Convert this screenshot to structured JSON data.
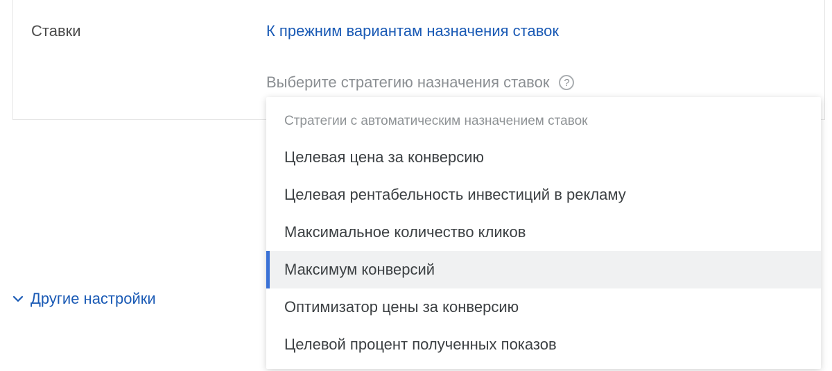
{
  "section_label": "Ставки",
  "back_link": "К прежним вариантам назначения ставок",
  "subheading": "Выберите стратегию назначения ставок",
  "other_settings": "Другие настройки",
  "dropdown": {
    "section_label": "Стратегии с автоматическим назначением ставок",
    "items": [
      {
        "label": "Целевая цена за конверсию",
        "selected": false
      },
      {
        "label": "Целевая рентабельность инвестиций в рекламу",
        "selected": false
      },
      {
        "label": "Максимальное количество кликов",
        "selected": false
      },
      {
        "label": "Максимум конверсий",
        "selected": true
      },
      {
        "label": "Оптимизатор цены за конверсию",
        "selected": false
      },
      {
        "label": "Целевой процент полученных показов",
        "selected": false
      }
    ]
  }
}
